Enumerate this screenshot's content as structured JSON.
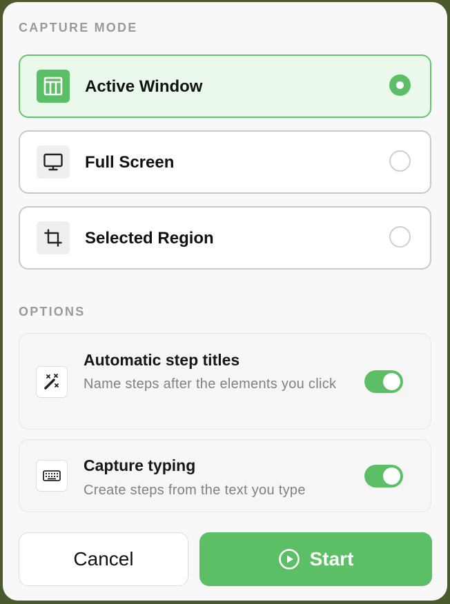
{
  "capture_mode": {
    "header": "CAPTURE MODE",
    "modes": [
      {
        "label": "Active Window",
        "icon": "window-icon",
        "selected": true
      },
      {
        "label": "Full Screen",
        "icon": "monitor-icon",
        "selected": false
      },
      {
        "label": "Selected Region",
        "icon": "crop-icon",
        "selected": false
      }
    ]
  },
  "options": {
    "header": "OPTIONS",
    "items": [
      {
        "title": "Automatic step titles",
        "description": "Name steps after the elements you click",
        "icon": "magic-wand-icon",
        "enabled": true
      },
      {
        "title": "Capture typing",
        "description": "Create steps from the text you type",
        "icon": "keyboard-icon",
        "enabled": true
      }
    ]
  },
  "actions": {
    "cancel_label": "Cancel",
    "start_label": "Start"
  },
  "colors": {
    "accent": "#5cbf65",
    "selected_bg": "#eaf9ec"
  }
}
